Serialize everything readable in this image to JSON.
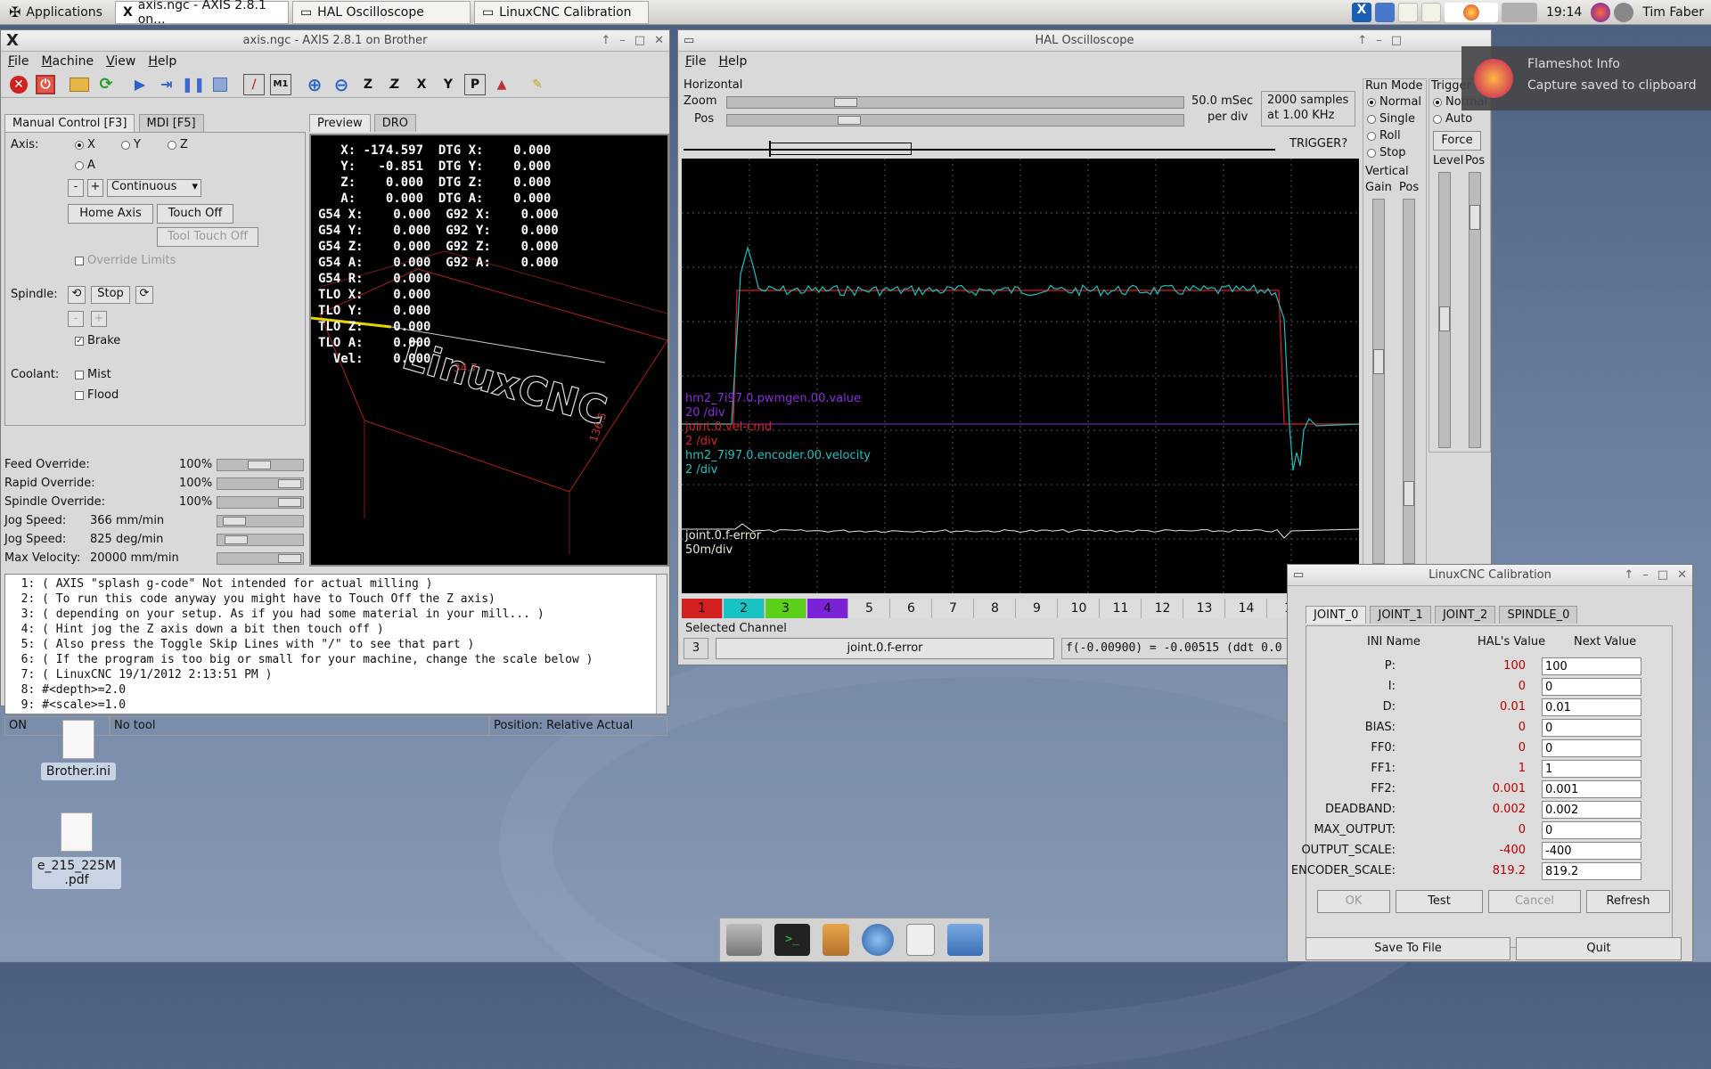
{
  "taskbar": {
    "applications": "Applications",
    "tasks": [
      "axis.ngc - AXIS 2.8.1 on...",
      "HAL Oscilloscope",
      "LinuxCNC Calibration"
    ],
    "clock": "19:14",
    "user": "Tim Faber"
  },
  "notification": {
    "title": "Flameshot Info",
    "body": "Capture saved to clipboard"
  },
  "axis": {
    "title": "axis.ngc - AXIS 2.8.1 on Brother",
    "menu": [
      "File",
      "Machine",
      "View",
      "Help"
    ],
    "tabs": [
      "Manual Control [F3]",
      "MDI [F5]"
    ],
    "axis_label": "Axis:",
    "axes": [
      "X",
      "Y",
      "Z",
      "A"
    ],
    "minus": "-",
    "plus": "+",
    "jog_mode": "Continuous",
    "home_axis": "Home Axis",
    "touch_off": "Touch Off",
    "tool_touch_off": "Tool Touch Off",
    "override_limits": "Override Limits",
    "spindle_label": "Spindle:",
    "stop": "Stop",
    "brake": "Brake",
    "coolant_label": "Coolant:",
    "mist": "Mist",
    "flood": "Flood",
    "overrides": [
      {
        "label": "Feed Override:",
        "value": "100%"
      },
      {
        "label": "Rapid Override:",
        "value": "100%"
      },
      {
        "label": "Spindle Override:",
        "value": "100%"
      },
      {
        "label": "Jog Speed:",
        "value": "366 mm/min"
      },
      {
        "label": "Jog Speed:",
        "value": "825 deg/min"
      },
      {
        "label": "Max Velocity:",
        "value": "20000 mm/min"
      }
    ],
    "view_tabs": [
      "Preview",
      "DRO"
    ],
    "dro": [
      "   X: -174.597  DTG X:    0.000",
      "   Y:   -0.851  DTG Y:    0.000",
      "   Z:    0.000  DTG Z:    0.000",
      "   A:    0.000  DTG A:    0.000",
      "G54 X:    0.000  G92 X:    0.000",
      "G54 Y:    0.000  G92 Y:    0.000",
      "G54 Z:    0.000  G92 Z:    0.000",
      "G54 A:    0.000  G92 A:    0.000",
      "G54 R:    0.000",
      "TLO X:    0.000",
      "TLO Y:    0.000",
      "TLO Z:    0.000",
      "TLO A:    0.000",
      "  Vel:    0.000"
    ],
    "preview_logo": "LinuxCNC",
    "dim1": "34.7",
    "dim2": "136.5",
    "gcode": [
      "  1: ( AXIS \"splash g-code\" Not intended for actual milling )",
      "  2: ( To run this code anyway you might have to Touch Off the Z axis)",
      "  3: ( depending on your setup. As if you had some material in your mill... )",
      "  4: ( Hint jog the Z axis down a bit then touch off )",
      "  5: ( Also press the Toggle Skip Lines with \"/\" to see that part )",
      "  6: ( If the program is too big or small for your machine, change the scale below )",
      "  7: ( LinuxCNC 19/1/2012 2:13:51 PM )",
      "  8: #<depth>=2.0",
      "  9: #<scale>=1.0"
    ],
    "status": [
      "ON",
      "No tool",
      "Position: Relative Actual"
    ]
  },
  "scope": {
    "title": "HAL Oscilloscope",
    "menu": [
      "File",
      "Help"
    ],
    "horizontal": "Horizontal",
    "zoom": "Zoom",
    "pos": "Pos",
    "time_div": "50.0 mSec",
    "per_div": "per div",
    "samples": "2000 samples",
    "rate": "at 1.00 KHz",
    "trigger_q": "TRIGGER?",
    "run_mode": "Run Mode",
    "run_modes": [
      "Normal",
      "Single",
      "Roll",
      "Stop"
    ],
    "trigger": "Trigger",
    "trigger_modes": [
      "Normal",
      "Auto"
    ],
    "force": "Force",
    "level": "Level",
    "tpos": "Pos",
    "vertical": "Vertical",
    "gain": "Gain",
    "vpos": "Pos",
    "traces": [
      {
        "name": "hm2_7i97.0.pwmgen.00.value",
        "scale": "20 /div",
        "color": "#8a2be2"
      },
      {
        "name": "joint.0.vel-cmd",
        "scale": "2 /div",
        "color": "#e01b24"
      },
      {
        "name": "hm2_7i97.0.encoder.00.velocity",
        "scale": "2 /div",
        "color": "#19c3c3"
      },
      {
        "name": "joint.0.f-error",
        "scale": "50m/div",
        "color": "#e8e8d8"
      }
    ],
    "channels": [
      "1",
      "2",
      "3",
      "4",
      "5",
      "6",
      "7",
      "8",
      "9",
      "10",
      "11",
      "12",
      "13",
      "14",
      "1"
    ],
    "selected_channel_label": "Selected Channel",
    "selected_channel": "3",
    "selected_name": "joint.0.f-error",
    "readout": "f(-0.00900) = -0.00515 (ddt  0.0"
  },
  "calibration": {
    "title": "LinuxCNC Calibration",
    "tabs": [
      "JOINT_0",
      "JOINT_1",
      "JOINT_2",
      "SPINDLE_0"
    ],
    "col_ini": "INI Name",
    "col_hal": "HAL's Value",
    "col_next": "Next Value",
    "rows": [
      {
        "name": "P:",
        "hal": "100",
        "next": "100"
      },
      {
        "name": "I:",
        "hal": "0",
        "next": "0"
      },
      {
        "name": "D:",
        "hal": "0.01",
        "next": "0.01"
      },
      {
        "name": "BIAS:",
        "hal": "0",
        "next": "0"
      },
      {
        "name": "FF0:",
        "hal": "0",
        "next": "0"
      },
      {
        "name": "FF1:",
        "hal": "1",
        "next": "1"
      },
      {
        "name": "FF2:",
        "hal": "0.001",
        "next": "0.001"
      },
      {
        "name": "DEADBAND:",
        "hal": "0.002",
        "next": "0.002"
      },
      {
        "name": "MAX_OUTPUT:",
        "hal": "0",
        "next": "0"
      },
      {
        "name": "OUTPUT_SCALE:",
        "hal": "-400",
        "next": "-400"
      },
      {
        "name": "ENCODER_SCALE:",
        "hal": "819.2",
        "next": "819.2"
      }
    ],
    "ok": "OK",
    "test": "Test",
    "cancel": "Cancel",
    "refresh": "Refresh",
    "save": "Save To File",
    "quit": "Quit"
  },
  "desktop": {
    "icons": [
      "Brother.ini",
      "e_215_225M\n.pdf"
    ]
  }
}
